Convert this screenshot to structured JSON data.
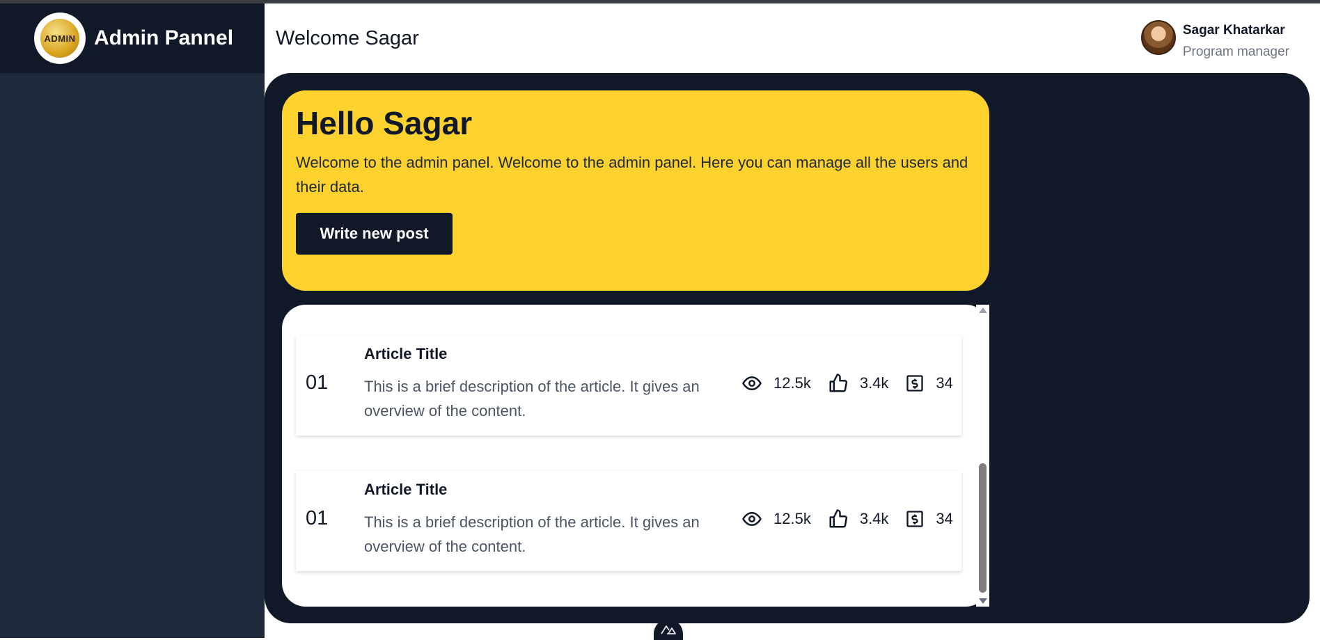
{
  "brand": {
    "logo_text": "ADMIN",
    "title": "Admin Pannel"
  },
  "header": {
    "welcome": "Welcome Sagar"
  },
  "user": {
    "name": "Sagar Khatarkar",
    "role": "Program manager"
  },
  "hero": {
    "heading": "Hello Sagar",
    "text": "Welcome to the admin panel. Welcome to the admin panel. Here you can manage all the users and their data.",
    "button_label": "Write new post"
  },
  "articles": [
    {
      "number": "01",
      "title": "Article Title",
      "description": "This is a brief description of the article. It gives an overview of the content.",
      "views": "12.5k",
      "likes": "3.4k",
      "earnings": "34"
    },
    {
      "number": "01",
      "title": "Article Title",
      "description": "This is a brief description of the article. It gives an overview of the content.",
      "views": "12.5k",
      "likes": "3.4k",
      "earnings": "34"
    }
  ],
  "icons": {
    "views": "eye-icon",
    "likes": "thumbs-up-icon",
    "earnings": "dollar-bill-icon",
    "footer": "nuxt-logo-icon"
  },
  "colors": {
    "accent": "#fdd22f",
    "dark": "#111827",
    "sidebar": "#1e293b"
  }
}
